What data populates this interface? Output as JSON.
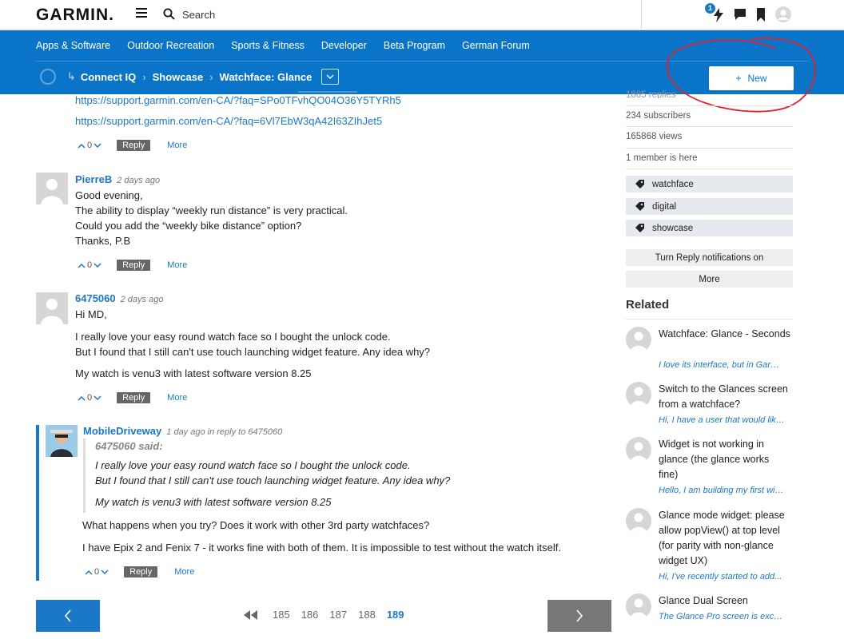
{
  "topbar": {
    "logo": "GARMIN.",
    "search_placeholder": "Search",
    "notif_count": "1"
  },
  "nav": {
    "links": [
      "Apps & Software",
      "Outdoor Recreation",
      "Sports & Fitness",
      "Developer",
      "Beta Program",
      "German Forum"
    ],
    "active": "Developer"
  },
  "breadcrumb": {
    "items": [
      "Connect IQ",
      "Showcase",
      "Watchface: Glance"
    ]
  },
  "new_button": {
    "label": "New",
    "plus": "+"
  },
  "post_links": [
    "https://support.garmin.com/en-CA/?faq=SPo0TFvhQO04O36Y5TYRh5",
    "https://support.garmin.com/en-CA/?faq=6Vl7EbW3qA42I63ZIhJet5"
  ],
  "actions": {
    "reply": "Reply",
    "more": "More",
    "votes": "0"
  },
  "comments": [
    {
      "author": "PierreB",
      "time": "2 days ago",
      "lines": [
        "Good evening,",
        "The ability to display “weekly run distance” is very practical.",
        "Could you add the “weekly bike distance” option?",
        "Thanks, P.B"
      ]
    },
    {
      "author": "6475060",
      "time": "2 days ago",
      "para1": "Hi MD,",
      "para2a": "I really love your easy round watch face so I bought the unlock code.",
      "para2b": "But I found that I still can't use touch launching widget feature. Any idea why?",
      "para3": "My watch is venu3 with latest software version 8.25"
    },
    {
      "author": "MobileDriveway",
      "time": "1 day ago in reply to 6475060",
      "quote_author": "6475060 said:",
      "quote_line1": "I really love your easy round watch face so I bought the unlock code.",
      "quote_line2": "But I found that I still can't use touch launching widget feature. Any idea why?",
      "quote_line3": "My watch is venu3 with latest software version 8.25",
      "para1": "What happens when you try? Does it work with other 3rd party watchfaces?",
      "para2": "I have Epix 2 and Fenix 7 - it works fine with both of them. It is impossible to test without the watch itself."
    }
  ],
  "pager": {
    "pages": [
      "185",
      "186",
      "187",
      "188",
      "189"
    ],
    "current": "189"
  },
  "sidebar": {
    "stats": [
      "1885 replies",
      "234 subscribers",
      "165868 views",
      "1 member is here"
    ],
    "tags": [
      "watchface",
      "digital",
      "showcase"
    ],
    "notify_btn": "Turn Reply notifications on",
    "more_btn": "More",
    "related_heading": "Related",
    "related": [
      {
        "title": "Watchface: Glance - Seconds",
        "excerpt": "I love its interface, but in Garmin..."
      },
      {
        "title": "Switch to the Glances screen from a watchface?",
        "excerpt": "Hi, I have a user that would like..."
      },
      {
        "title": "Widget is not working in glance (the glance works fine)",
        "excerpt": "Hello, I am building my first widget..."
      },
      {
        "title": "Glance mode widget: please allow popView() at top level (for parity with non-glance widget UX)",
        "excerpt": "Hi, I've recently started to add..."
      },
      {
        "title": "Glance Dual Screen",
        "excerpt": "The Glance Pro screen is excellent..."
      }
    ]
  },
  "colors": {
    "brand_blue": "#0a74c9",
    "link_blue": "#1b78c8",
    "annotation_red": "#e0202a"
  }
}
